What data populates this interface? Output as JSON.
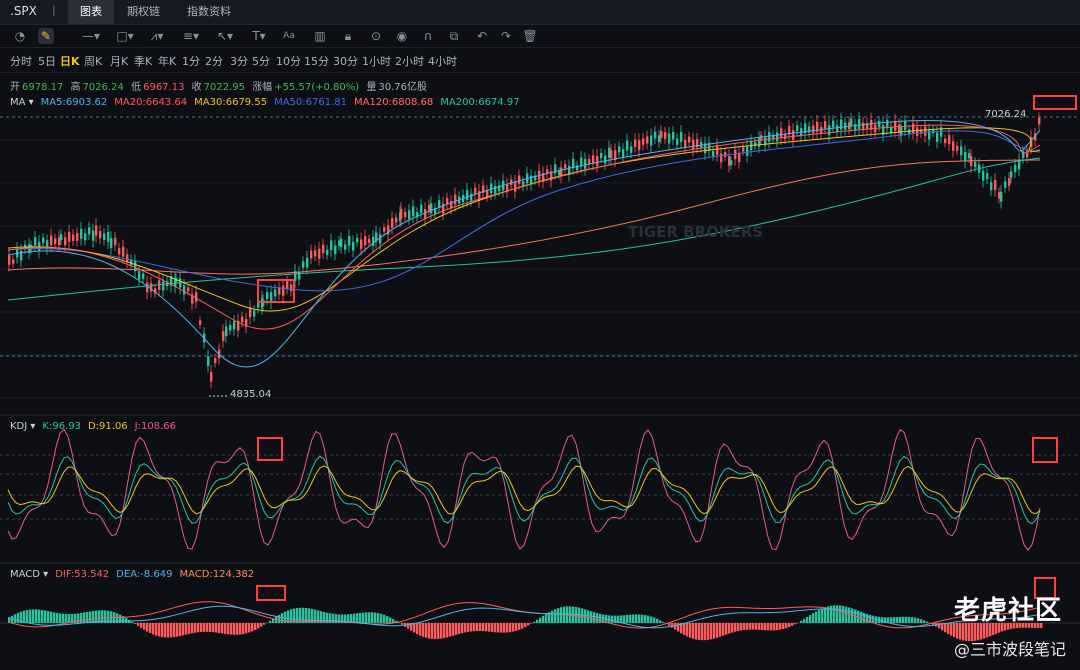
{
  "header": {
    "symbol": ".SPX",
    "separator": "|",
    "tabs": [
      {
        "label": "图表",
        "active": true
      },
      {
        "label": "期权链",
        "active": false
      },
      {
        "label": "指数资料",
        "active": false
      }
    ]
  },
  "toolbar": {
    "icons": [
      "gauge-icon",
      "draw-icon",
      "line-tool-icon",
      "rect-tool-icon",
      "pattern-tool-icon",
      "fib-tool-icon",
      "cursor-tool-icon",
      "text-tool-icon",
      "ab-tool-icon",
      "bar-chart-icon",
      "lock-icon",
      "eye-icon",
      "magnet-icon",
      "link-icon",
      "undo-icon",
      "redo-icon",
      "trash-icon"
    ]
  },
  "periods": [
    "分时",
    "5日",
    "日K",
    "周K",
    "月K",
    "季K",
    "年K",
    "1分",
    "2分",
    "3分",
    "5分",
    "10分",
    "15分",
    "30分",
    "1小时",
    "2小时",
    "4小时"
  ],
  "active_period": "日K",
  "ohlc": {
    "open_label": "开",
    "open": "6978.17",
    "high_label": "高",
    "high": "7026.24",
    "low_label": "低",
    "low": "6967.13",
    "close_label": "收",
    "close": "7022.95",
    "change_label": "涨幅",
    "change": "+55.57(+0.80%)",
    "volume_label": "量",
    "volume": "30.76亿股"
  },
  "ma": {
    "label": "MA",
    "items": [
      {
        "text": "MA5:6903.62",
        "color": "#4fb3e8"
      },
      {
        "text": "MA20:6643.64",
        "color": "#ff5b5b"
      },
      {
        "text": "MA30:6679.55",
        "color": "#f0c419"
      },
      {
        "text": "MA50:6761.81",
        "color": "#3d6de0"
      },
      {
        "text": "MA120:6808.68",
        "color": "#ff6f61"
      },
      {
        "text": "MA200:6674.97",
        "color": "#27c4a0"
      }
    ]
  },
  "kdj": {
    "label": "KDJ",
    "items": [
      {
        "text": "K:96.93",
        "color": "#27c4a0"
      },
      {
        "text": "D:91.06",
        "color": "#f0c419"
      },
      {
        "text": "J:108.66",
        "color": "#e85a8a"
      }
    ]
  },
  "macd": {
    "label": "MACD",
    "items": [
      {
        "text": "DIF:53.542",
        "color": "#ff5b5b"
      },
      {
        "text": "DEA:-8.649",
        "color": "#4fb3e8"
      },
      {
        "text": "MACD:124.382",
        "color": "#ff8a5b"
      }
    ]
  },
  "price_high_label": "7026.24",
  "price_low_label": "4835.04",
  "watermark_center": "TIGER BROKERS",
  "watermark_right": "老虎社区",
  "watermark_right2": "@三市波段笔记",
  "colors": {
    "up": "#27c4a0",
    "down": "#ff5b5b",
    "highlight": "#ff4040"
  }
}
